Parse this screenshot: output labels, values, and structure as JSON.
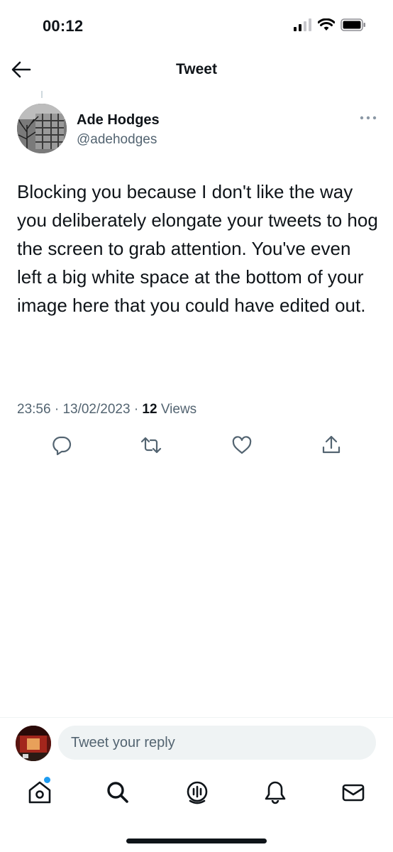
{
  "status_bar": {
    "time": "00:12"
  },
  "header": {
    "title": "Tweet"
  },
  "tweet": {
    "author_name": "Ade Hodges",
    "author_handle": "@adehodges",
    "text": "Blocking you because I don't like the way you deliberately elongate your tweets to hog the screen to grab attention. You've even left a big white space at the bottom of your image here that you could have edited out.",
    "time": "23:56",
    "date": "13/02/2023",
    "views_count": "12",
    "views_label": "Views",
    "separator": "·"
  },
  "actions": [
    "reply-icon",
    "retweet-icon",
    "like-icon",
    "share-icon"
  ],
  "reply_bar": {
    "placeholder": "Tweet your reply"
  },
  "tab_bar": [
    "home-icon",
    "search-icon",
    "spaces-icon",
    "notifications-icon",
    "messages-icon"
  ],
  "colors": {
    "text": "#0f1419",
    "secondary": "#536471",
    "accent": "#1d9bf0",
    "input_bg": "#eff3f4"
  }
}
